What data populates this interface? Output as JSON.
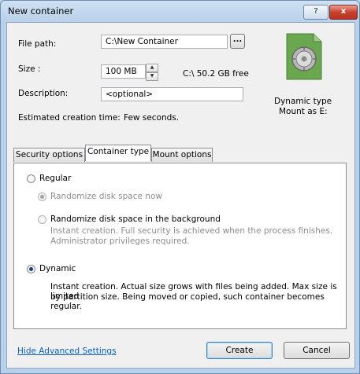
{
  "window": {
    "title": "New container",
    "help": "?",
    "close": "x"
  },
  "form": {
    "file_path_label": "File path:",
    "file_path_value": "C:\\New Container",
    "browse_label": "...",
    "size_label": "Size :",
    "size_value": "100 MB",
    "free_space": "C:\\ 50.2 GB free",
    "description_label": "Description:",
    "description_value": "<optional>",
    "estimated_label": "Estimated creation time:",
    "estimated_value": "Few seconds."
  },
  "summary": {
    "type_line": "Dynamic type",
    "mount_line": "Mount as E:"
  },
  "tabs": [
    {
      "label": "Security options"
    },
    {
      "label": "Container type"
    },
    {
      "label": "Mount options"
    }
  ],
  "options": {
    "regular_label": "Regular",
    "randomize_now_label": "Randomize disk space now",
    "randomize_bg_label": "Randomize disk space in the background",
    "randomize_bg_desc_1": "Instant creation. Full security is achieved when the process finishes.",
    "randomize_bg_desc_2": "Administrator privileges required.",
    "dynamic_label": "Dynamic",
    "dynamic_desc_1": "Instant creation. Actual size grows with files being added. Max size is limited",
    "dynamic_desc_2": "by partition size. Being moved or copied, such container becomes regular.",
    "selected": "Dynamic"
  },
  "footer": {
    "hide_advanced": "Hide Advanced Settings",
    "create": "Create",
    "cancel": "Cancel"
  },
  "colors": {
    "link": "#0b5dbd",
    "accent": "#3c7fb1",
    "icon_green": "#6aa84f"
  }
}
